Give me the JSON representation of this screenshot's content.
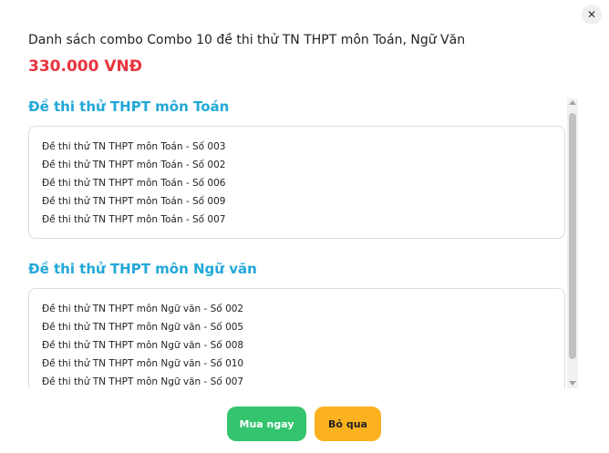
{
  "modal": {
    "close_label": "✕",
    "title": "Danh sách combo Combo 10 đề thi thử TN THPT môn Toán, Ngữ Văn",
    "price": "330.000 VNĐ"
  },
  "sections": [
    {
      "title": "Đề thi thử THPT môn Toán",
      "items": [
        "Đề thi thử TN THPT môn Toán - Số 003",
        "Đề thi thử TN THPT môn Toán - Số 002",
        "Đề thi thử TN THPT môn Toán - Số 006",
        "Đề thi thử TN THPT môn Toán - Số 009",
        "Đề thi thử TN THPT môn Toán - Số 007"
      ]
    },
    {
      "title": "Đề thi thử THPT môn Ngữ văn",
      "items": [
        "Đề thi thử TN THPT môn Ngữ văn - Số 002",
        "Đề thi thử TN THPT môn Ngữ văn - Số 005",
        "Đề thi thử TN THPT môn Ngữ văn - Số 008",
        "Đề thi thử TN THPT môn Ngữ văn - Số 010",
        "Đề thi thử TN THPT môn Ngữ văn - Số 007"
      ]
    }
  ],
  "actions": {
    "buy_label": "Mua ngay",
    "skip_label": "Bỏ qua"
  },
  "colors": {
    "price": "#e8343f",
    "section_title": "#22a8d8",
    "buy_button": "#34c46e",
    "skip_button": "#fbb21e"
  },
  "icons": {
    "close": "close-icon"
  }
}
